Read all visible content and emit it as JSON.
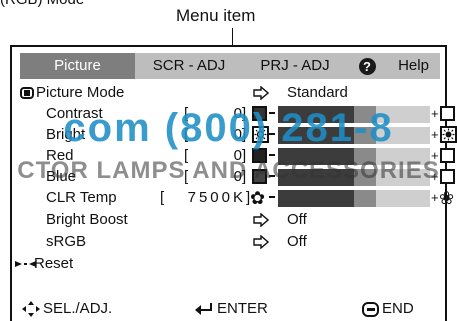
{
  "caption": "(RGB) Mode",
  "callout": "Menu item",
  "menu": {
    "tabs": [
      {
        "label": "Picture"
      },
      {
        "label": "SCR - ADJ"
      },
      {
        "label": "PRJ - ADJ"
      },
      {
        "label": "Help"
      }
    ],
    "help_glyph": "?"
  },
  "settings": {
    "picture_mode": {
      "label": "Picture Mode",
      "value": "Standard"
    },
    "contrast": {
      "label": "Contrast",
      "value": "0"
    },
    "bright": {
      "label": "Bright",
      "value": "0"
    },
    "red": {
      "label": "Red",
      "value": "0"
    },
    "blue": {
      "label": "Blue",
      "value": "0"
    },
    "clr_temp": {
      "label": "CLR Temp",
      "value": "7500K"
    },
    "bright_boost": {
      "label": "Bright Boost",
      "value": "Off"
    },
    "srgb": {
      "label": "sRGB",
      "value": "Off"
    },
    "reset": {
      "label": "Reset"
    }
  },
  "bars": {
    "contrast_fraction": 0.5,
    "bright_fraction": 0.5,
    "red_fraction": 0.5,
    "blue_fraction": 0.5,
    "clr_temp_fraction": 0.5
  },
  "footer": {
    "sel_label": "SEL./ADJ.",
    "enter_label": "ENTER",
    "end_label": "END"
  },
  "watermark": {
    "line1": "com (800) 281-8",
    "line2": "CTOR LAMPS AND ACCESSORIES"
  }
}
